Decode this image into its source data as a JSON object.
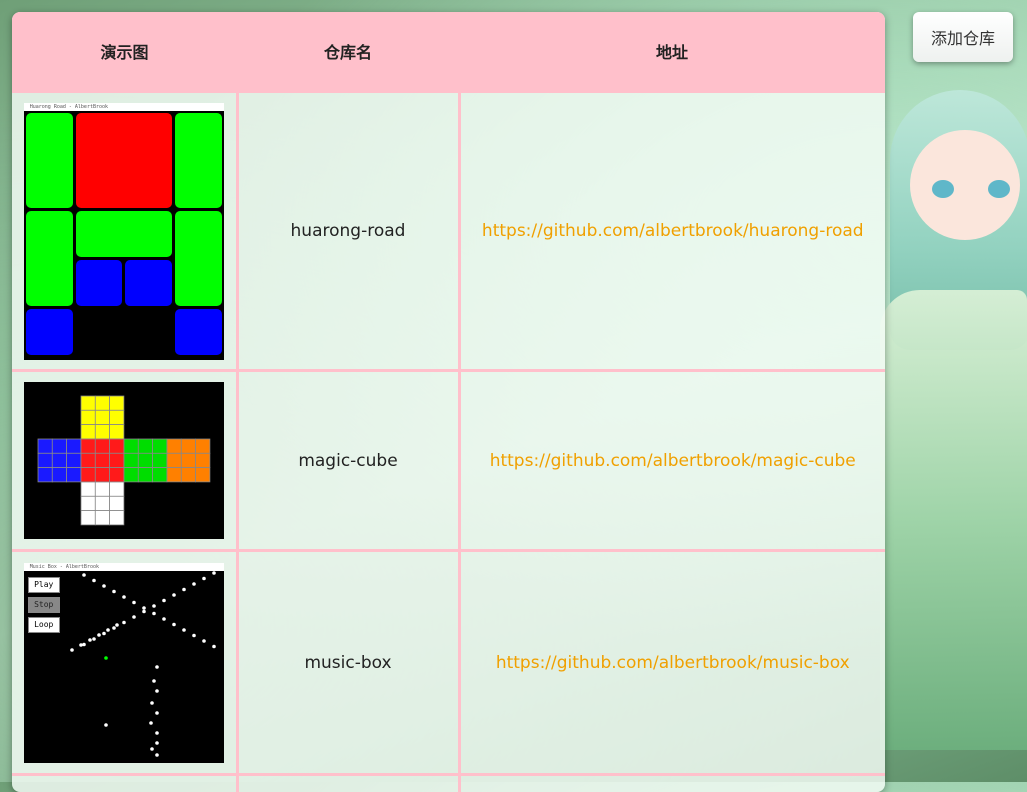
{
  "header": {
    "col_image": "演示图",
    "col_name": "仓库名",
    "col_url": "地址"
  },
  "toolbar": {
    "add_label": "添加仓库"
  },
  "rows": [
    {
      "name": "huarong-road",
      "url": "https://github.com/albertbrook/huarong-road",
      "window_title": "Huarong Road - AlbertBrook"
    },
    {
      "name": "magic-cube",
      "url": "https://github.com/albertbrook/magic-cube"
    },
    {
      "name": "music-box",
      "url": "https://github.com/albertbrook/music-box",
      "window_title": "Music Box - AlbertBrook",
      "buttons": {
        "play": "Play",
        "stop": "Stop",
        "loop": "Loop"
      }
    }
  ],
  "colors": {
    "header_pink": "#ffc0cb",
    "link": "#f0a000"
  }
}
